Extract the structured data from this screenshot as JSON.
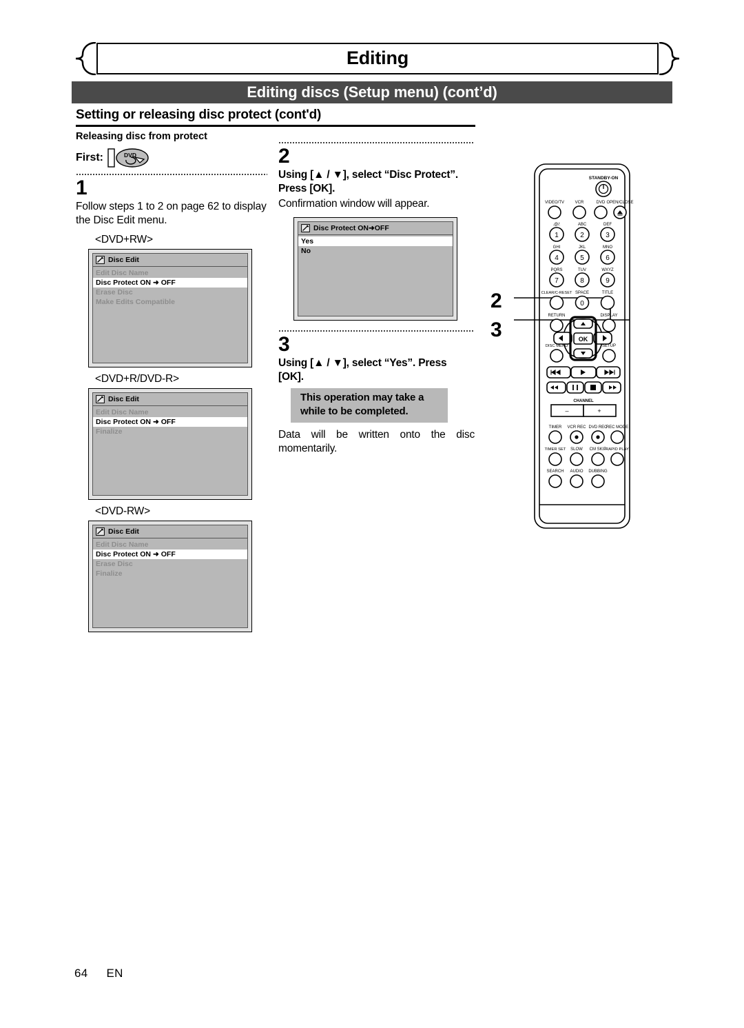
{
  "header": {
    "chapter": "Editing",
    "section_bar": "Editing discs (Setup menu) (cont’d)",
    "subsection": "Setting or releasing disc protect (cont'd)"
  },
  "left_column": {
    "lead": "Releasing disc from protect",
    "first_label": "First:",
    "disc_icon_label": "DVD",
    "step1": {
      "number": "1",
      "text": "Follow steps 1 to 2 on page 62 to display the Disc Edit menu."
    },
    "menus": [
      {
        "disc_type": "<DVD+RW>",
        "title": "Disc Edit",
        "rows": [
          {
            "label": "Edit Disc Name",
            "highlight": false
          },
          {
            "label": "Disc Protect ON",
            "arrow": "➜",
            "value": "OFF",
            "highlight": true
          },
          {
            "label": "Erase Disc",
            "highlight": false
          },
          {
            "label": "Make Edits Compatible",
            "highlight": false
          }
        ]
      },
      {
        "disc_type": "<DVD+R/DVD-R>",
        "title": "Disc Edit",
        "rows": [
          {
            "label": "Edit Disc Name",
            "highlight": false
          },
          {
            "label": "Disc Protect ON",
            "arrow": "➜",
            "value": "OFF",
            "highlight": true
          },
          {
            "label": "Finalize",
            "highlight": false
          }
        ]
      },
      {
        "disc_type": "<DVD-RW>",
        "title": "Disc Edit",
        "rows": [
          {
            "label": "Edit Disc Name",
            "highlight": false
          },
          {
            "label": "Disc Protect ON",
            "arrow": "➜",
            "value": "OFF",
            "highlight": true
          },
          {
            "label": "Erase Disc",
            "highlight": false
          },
          {
            "label": "Finalize",
            "highlight": false
          }
        ]
      }
    ]
  },
  "mid_column": {
    "step2": {
      "number": "2",
      "heading": "Using [▲ / ▼], select “Disc Protect”. Press [OK].",
      "subtext": "Confirmation window will appear.",
      "dialog": {
        "title": "Disc Protect ON",
        "title_arrow": "➜",
        "title_value": "OFF",
        "rows": [
          {
            "label": "Yes",
            "highlight": true
          },
          {
            "label": "No",
            "highlight": false
          }
        ]
      }
    },
    "step3": {
      "number": "3",
      "heading": "Using [▲ / ▼], select “Yes”. Press [OK].",
      "note": "This operation may take a while to be completed.",
      "subtext": "Data will be written onto the disc momentarily."
    }
  },
  "remote": {
    "callouts": [
      "2",
      "3"
    ],
    "standby_label": "STANDBY-ON",
    "source_buttons": [
      "VIDEO/TV",
      "VCR",
      "DVD",
      "OPEN/CLOSE"
    ],
    "keypad": [
      {
        "top": ".@/:",
        "num": "1"
      },
      {
        "top": "ABC",
        "num": "2"
      },
      {
        "top": "DEF",
        "num": "3"
      },
      {
        "top": "GHI",
        "num": "4"
      },
      {
        "top": "JKL",
        "num": "5"
      },
      {
        "top": "MNO",
        "num": "6"
      },
      {
        "top": "PQRS",
        "num": "7"
      },
      {
        "top": "TUV",
        "num": "8"
      },
      {
        "top": "WXYZ",
        "num": "9"
      },
      {
        "top": "CLEAR/C-RESET",
        "num": ""
      },
      {
        "top": "SPACE",
        "num": "0"
      },
      {
        "top": "TITLE",
        "num": ""
      }
    ],
    "nav_labels": {
      "return": "RETURN",
      "display": "DISPLAY",
      "disc_menu": "DISC MENU",
      "setup": "SETUP",
      "ok": "OK"
    },
    "channel_label": "CHANNEL",
    "channel_minus": "–",
    "channel_plus": "+",
    "function_rows": [
      [
        "TIMER",
        "VCR REC",
        "DVD REC",
        "REC MODE"
      ],
      [
        "TIMER SET",
        "SLOW",
        "CM SKIP",
        "RAPID PLAY"
      ],
      [
        "SEARCH",
        "AUDIO",
        "DUBBING"
      ]
    ]
  },
  "footer": {
    "page": "64",
    "lang": "EN"
  },
  "colors": {
    "bar_gray": "#4a4a4a",
    "osd_body_gray": "#b8b8b8",
    "osd_frame_gray": "#e2e2e2",
    "osd_dim_text": "#8d8d8d",
    "note_gray": "#b8b8b8"
  }
}
